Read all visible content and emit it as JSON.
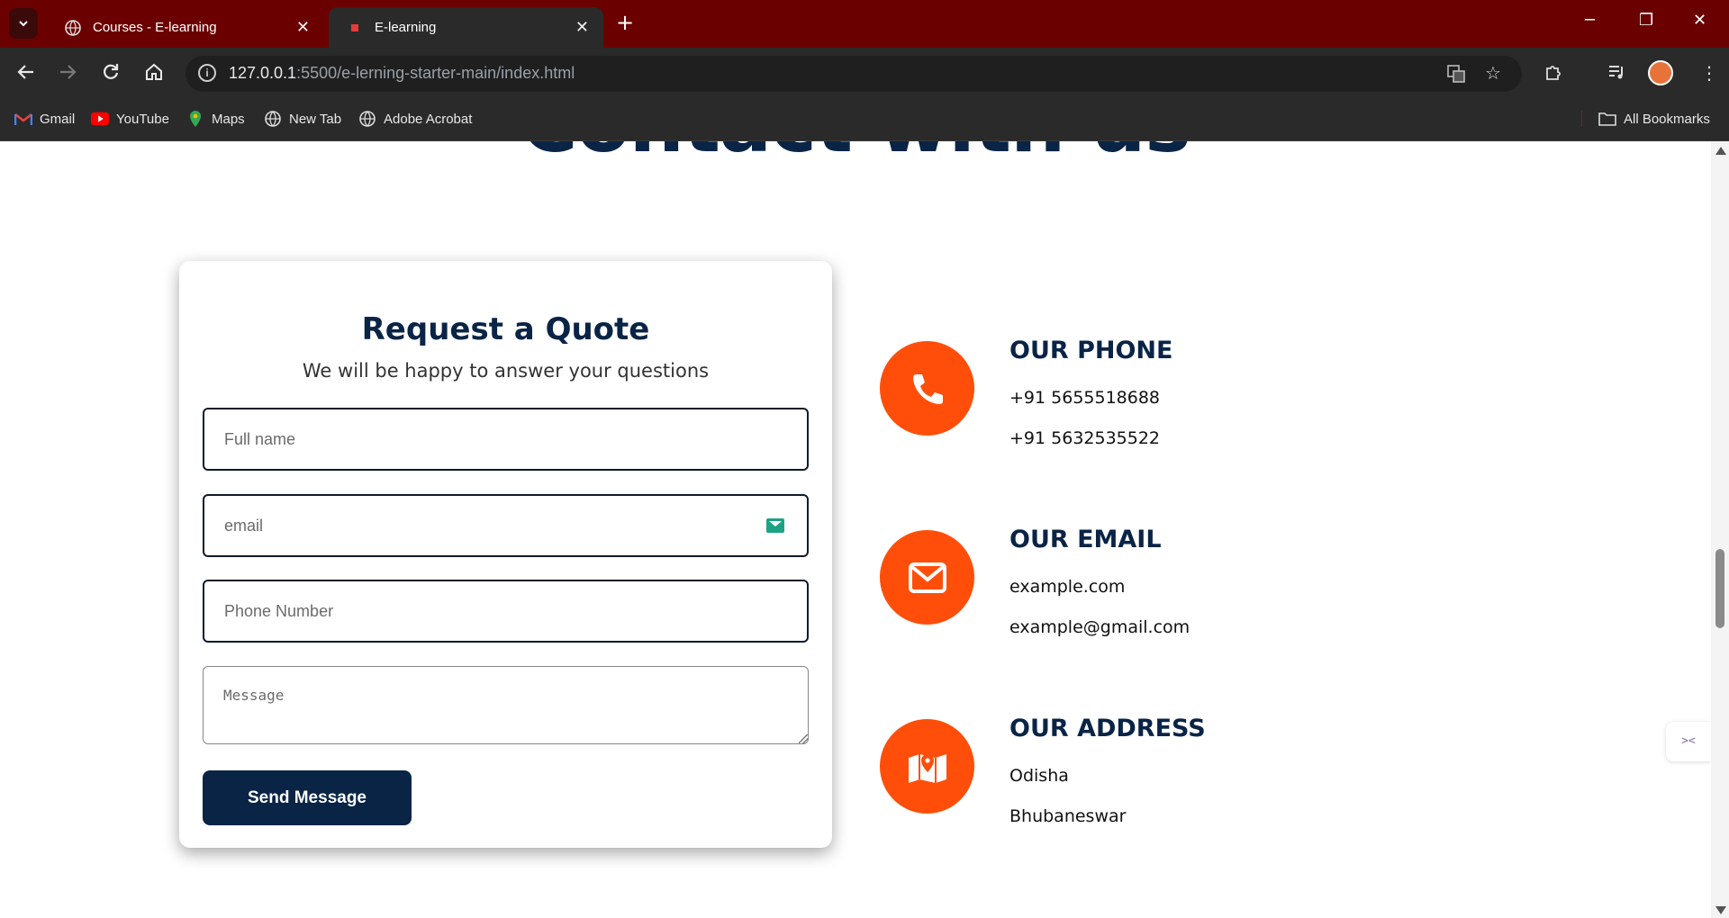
{
  "browser": {
    "tabs": [
      {
        "title": "Courses - E-learning",
        "icon": "globe-icon"
      },
      {
        "title": "E-learning",
        "icon": "site-favicon"
      }
    ],
    "url_host": "127.0.0.1",
    "url_rest": ":5500/e-lerning-starter-main/index.html",
    "bookmarks": [
      {
        "label": "Gmail",
        "icon": "gmail-icon"
      },
      {
        "label": "YouTube",
        "icon": "youtube-icon"
      },
      {
        "label": "Maps",
        "icon": "maps-icon"
      },
      {
        "label": "New Tab",
        "icon": "globe-icon"
      },
      {
        "label": "Adobe Acrobat",
        "icon": "globe-icon"
      }
    ],
    "all_bookmarks": "All Bookmarks"
  },
  "page": {
    "title": "Contact with us",
    "quote": {
      "title": "Request a Quote",
      "subtitle": "We will be happy to answer your questions",
      "name_placeholder": "Full name",
      "email_placeholder": "email",
      "phone_placeholder": "Phone Number",
      "message_placeholder": "Message",
      "send_label": "Send Message"
    },
    "contacts": [
      {
        "heading": "OUR PHONE",
        "lines": [
          "+91 5655518688",
          "+91 5632535522"
        ],
        "icon": "phone-icon"
      },
      {
        "heading": "OUR EMAIL",
        "lines": [
          "example.com",
          "example@gmail.com"
        ],
        "icon": "envelope-icon"
      },
      {
        "heading": "OUR ADDRESS",
        "lines": [
          "Odisha",
          "Bhubaneswar"
        ],
        "icon": "map-icon"
      }
    ]
  },
  "colors": {
    "brand_dark": "#0a2446",
    "accent_orange": "#ff4e0a",
    "tabbar": "#6b0000"
  }
}
